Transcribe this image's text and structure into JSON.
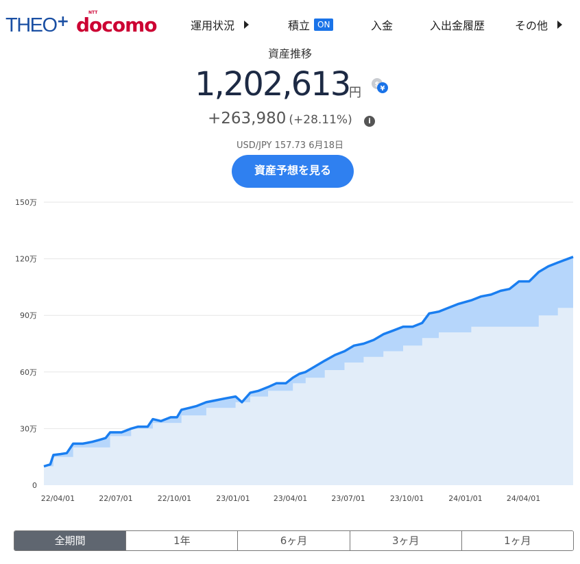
{
  "brand": {
    "theo": "THEO",
    "plus": "+",
    "docomo": "docomo",
    "ntt": "NTT"
  },
  "nav": {
    "items": [
      {
        "label": "運用状況",
        "has_arrow": true
      },
      {
        "label": "積立",
        "badge": "ON"
      },
      {
        "label": "入金"
      },
      {
        "label": "入出金履歴"
      },
      {
        "label": "その他",
        "has_arrow": true
      }
    ]
  },
  "summary": {
    "title": "資産推移",
    "total": "1,202,613",
    "currency": "円",
    "gain": "+263,980",
    "gain_pct": "(+28.11%)",
    "rate_text": "USD/JPY 157.73 6月18日",
    "forecast_button": "資産予想を見る",
    "fx_icon": "dollar-yen-exchange-icon",
    "info_icon": "info-icon"
  },
  "colors": {
    "line": "#1a7ef0",
    "gain_area": "#b6d6fb",
    "deposit_area": "#e2edf9",
    "button": "#2f80f0",
    "active_tab": "#5f6670"
  },
  "chart_data": {
    "type": "area",
    "unit": "万",
    "y_ticks": [
      "150万",
      "120万",
      "90万",
      "60万",
      "30万",
      "0"
    ],
    "x_ticks": [
      "22/04/01",
      "22/07/01",
      "22/10/01",
      "23/01/01",
      "23/04/01",
      "23/07/01",
      "23/10/01",
      "24/01/01",
      "24/04/01"
    ],
    "ylim": [
      0,
      150
    ],
    "x_start": "2022-03-10",
    "x_end": "2024-06-18",
    "grid": true,
    "series": [
      {
        "kind": "total",
        "points": [
          [
            "2022-03-10",
            10
          ],
          [
            "2022-03-20",
            11
          ],
          [
            "2022-03-25",
            16
          ],
          [
            "2022-04-05",
            16.5
          ],
          [
            "2022-04-15",
            17
          ],
          [
            "2022-04-25",
            22
          ],
          [
            "2022-05-10",
            22
          ],
          [
            "2022-05-25",
            23
          ],
          [
            "2022-06-05",
            24
          ],
          [
            "2022-06-15",
            25
          ],
          [
            "2022-06-22",
            28
          ],
          [
            "2022-07-10",
            28
          ],
          [
            "2022-07-25",
            30
          ],
          [
            "2022-08-05",
            31
          ],
          [
            "2022-08-20",
            31
          ],
          [
            "2022-08-28",
            35
          ],
          [
            "2022-09-10",
            34
          ],
          [
            "2022-09-25",
            36
          ],
          [
            "2022-10-05",
            36
          ],
          [
            "2022-10-12",
            40
          ],
          [
            "2022-10-25",
            41
          ],
          [
            "2022-11-05",
            42
          ],
          [
            "2022-11-20",
            44
          ],
          [
            "2022-12-05",
            45
          ],
          [
            "2022-12-20",
            46
          ],
          [
            "2023-01-05",
            47
          ],
          [
            "2023-01-15",
            44
          ],
          [
            "2023-01-28",
            49
          ],
          [
            "2023-02-10",
            50
          ],
          [
            "2023-02-25",
            52
          ],
          [
            "2023-03-10",
            54
          ],
          [
            "2023-03-25",
            54
          ],
          [
            "2023-04-05",
            57
          ],
          [
            "2023-04-15",
            59
          ],
          [
            "2023-04-25",
            60
          ],
          [
            "2023-05-10",
            63
          ],
          [
            "2023-05-25",
            66
          ],
          [
            "2023-06-10",
            69
          ],
          [
            "2023-06-25",
            71
          ],
          [
            "2023-07-10",
            74
          ],
          [
            "2023-07-25",
            75
          ],
          [
            "2023-08-10",
            77
          ],
          [
            "2023-08-25",
            80
          ],
          [
            "2023-09-10",
            82
          ],
          [
            "2023-09-25",
            84
          ],
          [
            "2023-10-10",
            84
          ],
          [
            "2023-10-25",
            86
          ],
          [
            "2023-11-05",
            91
          ],
          [
            "2023-11-20",
            92
          ],
          [
            "2023-12-05",
            94
          ],
          [
            "2023-12-20",
            96
          ],
          [
            "2024-01-10",
            98
          ],
          [
            "2024-01-25",
            100
          ],
          [
            "2024-02-10",
            101
          ],
          [
            "2024-02-25",
            103
          ],
          [
            "2024-03-10",
            104
          ],
          [
            "2024-03-25",
            108
          ],
          [
            "2024-04-10",
            108
          ],
          [
            "2024-04-25",
            113
          ],
          [
            "2024-05-10",
            116
          ],
          [
            "2024-05-25",
            118
          ],
          [
            "2024-06-18",
            121
          ]
        ]
      },
      {
        "kind": "deposit",
        "steps": [
          [
            "2022-03-10",
            10
          ],
          [
            "2022-03-25",
            15
          ],
          [
            "2022-04-25",
            20
          ],
          [
            "2022-06-22",
            26
          ],
          [
            "2022-07-25",
            30
          ],
          [
            "2022-08-28",
            33
          ],
          [
            "2022-10-12",
            37
          ],
          [
            "2022-11-20",
            41
          ],
          [
            "2023-01-05",
            44
          ],
          [
            "2023-01-28",
            47
          ],
          [
            "2023-02-25",
            50
          ],
          [
            "2023-04-05",
            54
          ],
          [
            "2023-04-25",
            57
          ],
          [
            "2023-05-25",
            61
          ],
          [
            "2023-06-25",
            65
          ],
          [
            "2023-07-25",
            68
          ],
          [
            "2023-08-25",
            71
          ],
          [
            "2023-09-25",
            74
          ],
          [
            "2023-10-25",
            78
          ],
          [
            "2023-11-20",
            81
          ],
          [
            "2024-01-10",
            84
          ],
          [
            "2024-04-25",
            90
          ],
          [
            "2024-05-25",
            94
          ]
        ]
      }
    ]
  },
  "periods": {
    "tabs": [
      {
        "label": "全期間",
        "active": true
      },
      {
        "label": "1年",
        "active": false
      },
      {
        "label": "6ヶ月",
        "active": false
      },
      {
        "label": "3ヶ月",
        "active": false
      },
      {
        "label": "1ヶ月",
        "active": false
      }
    ]
  }
}
